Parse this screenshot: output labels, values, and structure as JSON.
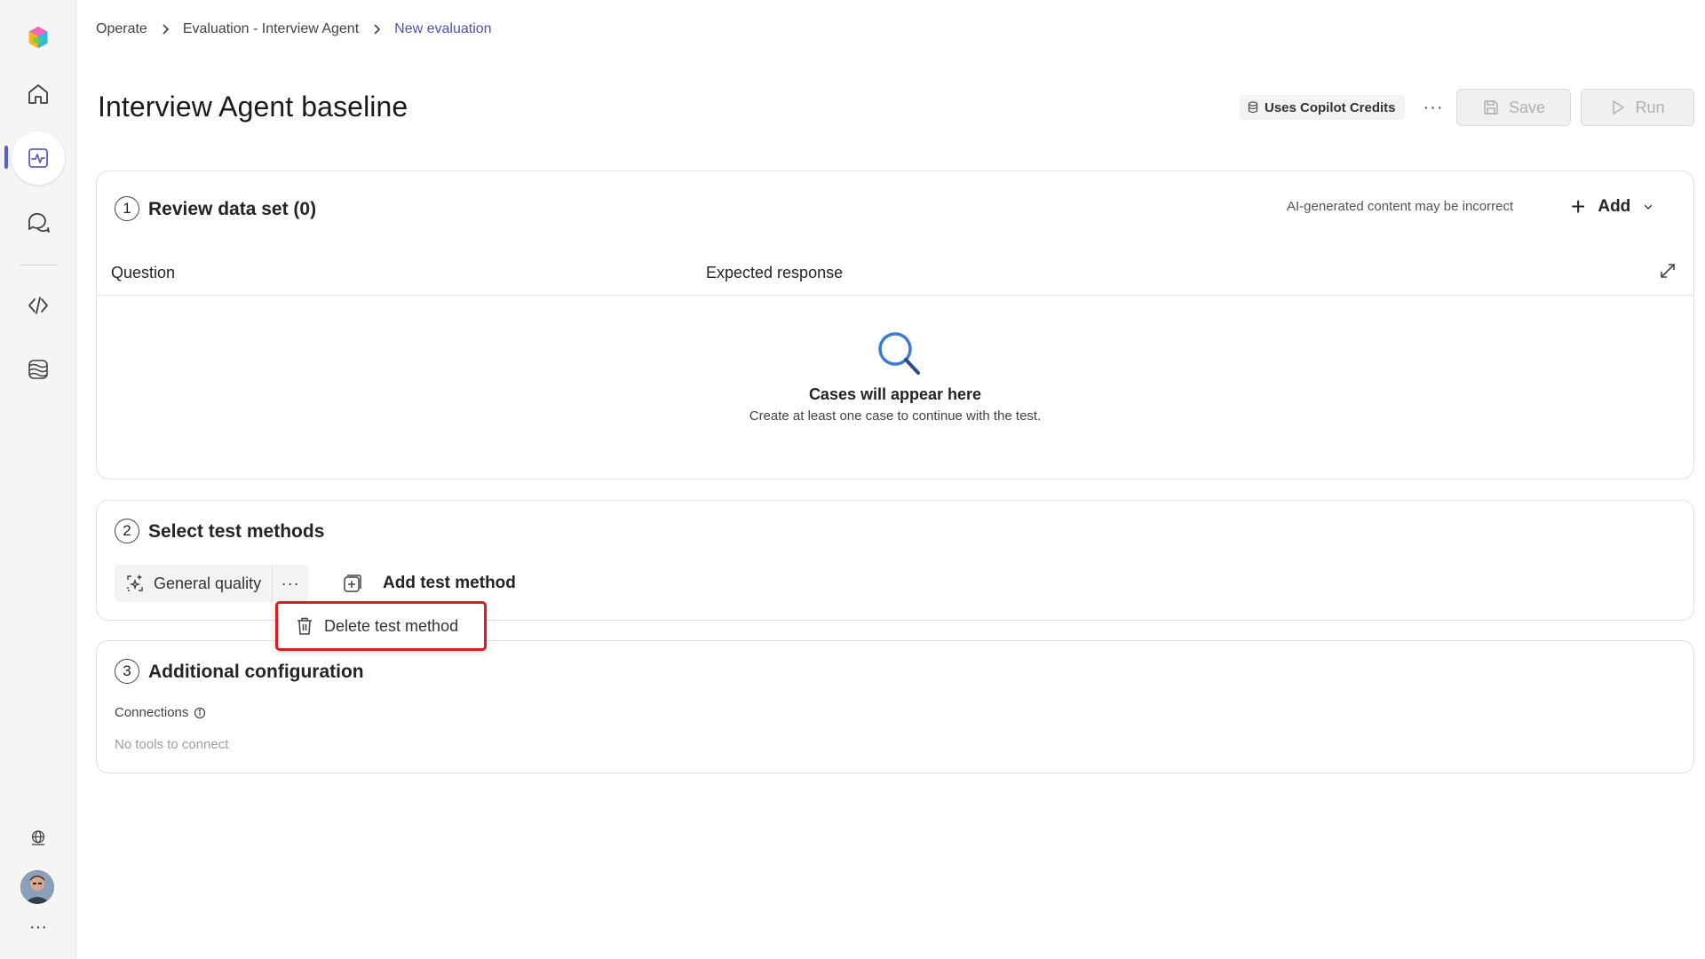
{
  "breadcrumb": {
    "items": [
      "Operate",
      "Evaluation - Interview Agent"
    ],
    "current": "New evaluation"
  },
  "header": {
    "title": "Interview Agent baseline",
    "credits_label": "Uses Copilot Credits",
    "more_label": "···",
    "save_label": "Save",
    "run_label": "Run"
  },
  "section1": {
    "number": "1",
    "title": "Review data set (0)",
    "ai_note": "AI-generated content may be incorrect",
    "add_label": "Add",
    "columns": [
      "Question",
      "Expected response"
    ],
    "empty_title": "Cases will appear here",
    "empty_subtitle": "Create at least one case to continue with the test."
  },
  "section2": {
    "number": "2",
    "title": "Select test methods",
    "method_label": "General quality",
    "method_more": "···",
    "add_method_label": "Add test method",
    "popup_item": "Delete test method"
  },
  "section3": {
    "number": "3",
    "title": "Additional configuration",
    "connections_label": "Connections",
    "connections_empty": "No tools to connect"
  },
  "rail": {
    "items": [
      "home-icon",
      "evaluation-icon",
      "chat-icon",
      "code-icon",
      "knowledge-icon"
    ],
    "bottom": [
      "globe-icon",
      "avatar",
      "more-icon"
    ],
    "more_label": "···"
  },
  "colors": {
    "accent": "#5b5fc7",
    "breadcrumb_current": "#4f52b2",
    "highlight_border": "#d81e1e"
  }
}
